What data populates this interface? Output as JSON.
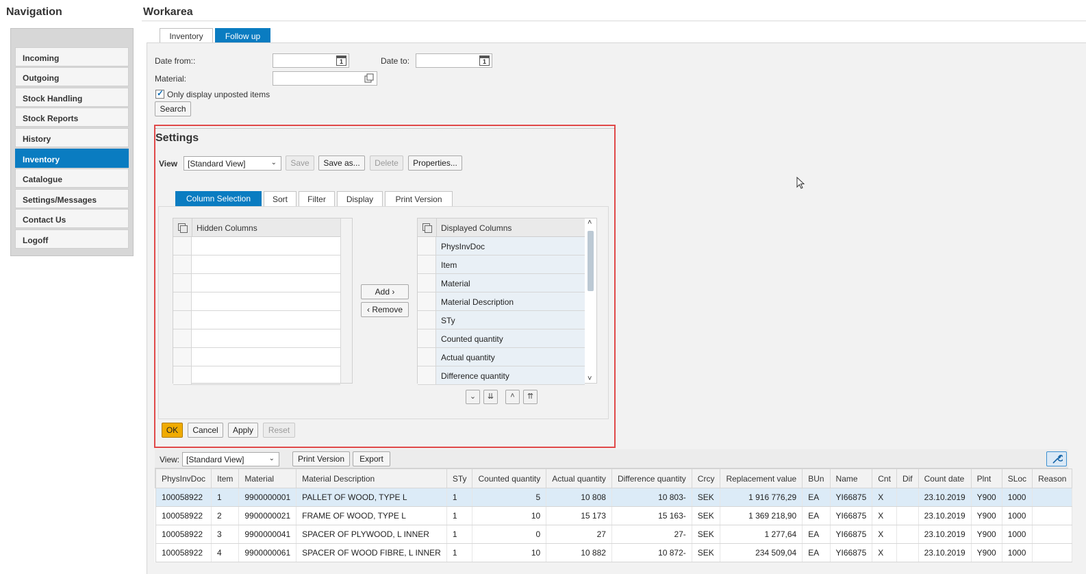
{
  "nav": {
    "title": "Navigation",
    "items": [
      {
        "label": "Incoming"
      },
      {
        "label": "Outgoing"
      },
      {
        "label": "Stock Handling"
      },
      {
        "label": "Stock Reports"
      },
      {
        "label": "History"
      },
      {
        "label": "Inventory",
        "active": true
      },
      {
        "label": "Catalogue"
      },
      {
        "label": "Settings/Messages"
      },
      {
        "label": "Contact Us"
      },
      {
        "label": "Logoff"
      }
    ]
  },
  "work": {
    "title": "Workarea",
    "tabs": [
      {
        "label": "Inventory",
        "active": false
      },
      {
        "label": "Follow up",
        "active": true
      }
    ]
  },
  "filters": {
    "date_from_label": "Date from::",
    "date_from_value": "",
    "date_to_label": "Date to:",
    "date_to_value": "",
    "calendar_glyph": "1",
    "material_label": "Material:",
    "material_value": "",
    "only_unposted_label": "Only display unposted items",
    "only_unposted_checked": true,
    "search_label": "Search"
  },
  "settings": {
    "title": "Settings",
    "view_label": "View",
    "view_value": "[Standard View]",
    "buttons": {
      "save": "Save",
      "save_as": "Save as...",
      "delete": "Delete",
      "properties": "Properties..."
    },
    "tabs": [
      "Column Selection",
      "Sort",
      "Filter",
      "Display",
      "Print Version"
    ],
    "active_tab": "Column Selection",
    "hidden_columns_header": "Hidden Columns",
    "displayed_columns_header": "Displayed Columns",
    "displayed_columns": [
      "PhysInvDoc",
      "Item",
      "Material",
      "Material Description",
      "STy",
      "Counted quantity",
      "Actual quantity",
      "Difference quantity"
    ],
    "add_label": "Add",
    "remove_label": "Remove",
    "footer": {
      "ok": "OK",
      "cancel": "Cancel",
      "apply": "Apply",
      "reset": "Reset"
    }
  },
  "results": {
    "view_label": "View:",
    "view_value": "[Standard View]",
    "print_version_label": "Print Version",
    "export_label": "Export",
    "columns": [
      "PhysInvDoc",
      "Item",
      "Material",
      "Material Description",
      "STy",
      "Counted quantity",
      "Actual quantity",
      "Difference quantity",
      "Crcy",
      "Replacement value",
      "BUn",
      "Name",
      "Cnt",
      "Dif",
      "Count date",
      "Plnt",
      "SLoc",
      "Reason"
    ],
    "rows": [
      [
        "100058922",
        "1",
        "9900000001",
        "PALLET OF WOOD, TYPE L",
        "1",
        "5",
        "10 808",
        "10 803-",
        "SEK",
        "1 916 776,29",
        "EA",
        "YI66875",
        "X",
        "",
        "23.10.2019",
        "Y900",
        "1000",
        ""
      ],
      [
        "100058922",
        "2",
        "9900000021",
        "FRAME OF WOOD, TYPE L",
        "1",
        "10",
        "15 173",
        "15 163-",
        "SEK",
        "1 369 218,90",
        "EA",
        "YI66875",
        "X",
        "",
        "23.10.2019",
        "Y900",
        "1000",
        ""
      ],
      [
        "100058922",
        "3",
        "9900000041",
        "SPACER OF PLYWOOD, L INNER",
        "1",
        "0",
        "27",
        "27-",
        "SEK",
        "1 277,64",
        "EA",
        "YI66875",
        "X",
        "",
        "23.10.2019",
        "Y900",
        "1000",
        ""
      ],
      [
        "100058922",
        "4",
        "9900000061",
        "SPACER OF WOOD FIBRE, L INNER",
        "1",
        "10",
        "10 882",
        "10 872-",
        "SEK",
        "234 509,04",
        "EA",
        "YI66875",
        "X",
        "",
        "23.10.2019",
        "Y900",
        "1000",
        ""
      ]
    ],
    "selected_row": 0
  },
  "colors": {
    "accent": "#0a7cc1",
    "highlight_border": "#e04848",
    "ok_button": "#f0ab00"
  }
}
